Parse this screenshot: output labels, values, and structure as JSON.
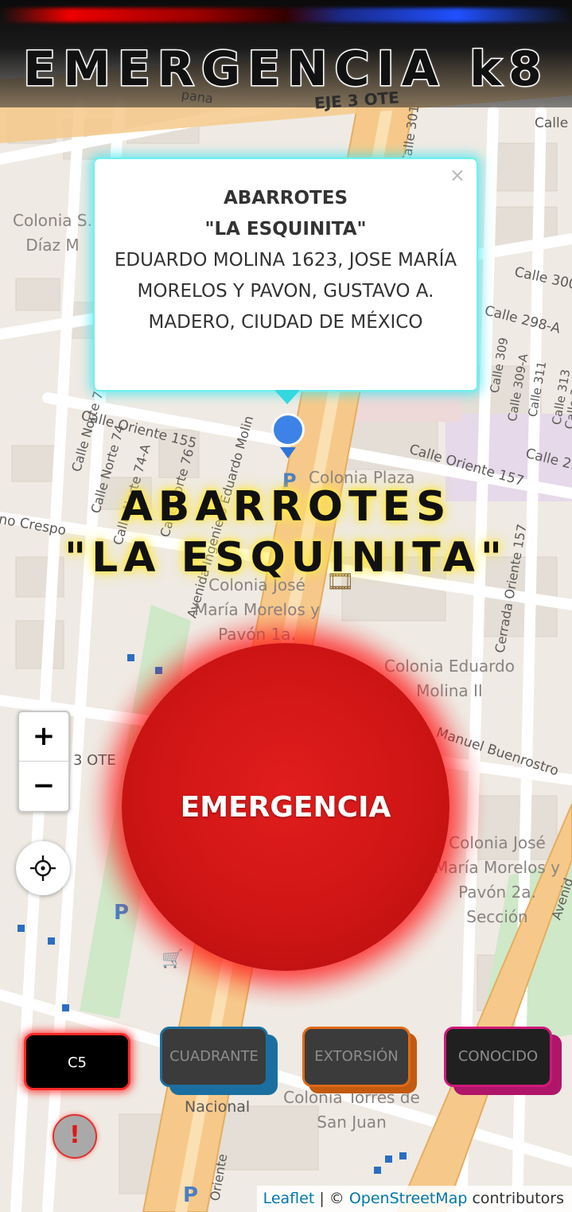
{
  "app": {
    "title": "EMERGENCIA k8"
  },
  "map": {
    "road_labels": [
      "EJE 3 OTE",
      "Calle 301",
      "Calle",
      "Calle 300",
      "Calle 298-A",
      "Calle 309",
      "Calle 309-A",
      "Calle 311",
      "Calle 313",
      "Calle 31",
      "Calle 29",
      "Calle Oriente 155",
      "Calle Oriente 157",
      "Calle Norte 72-B",
      "Calle Norte 74",
      "Calle Norte 74-A",
      "Calle Norte 76",
      "Avenida Ingeniero Eduardo Molin",
      "Cerrada Oriente 157",
      "Manuel Buenrostro",
      "3 OTE",
      "no Crespo",
      "Avenid",
      "pana",
      "Oriente",
      "Nacional"
    ],
    "area_labels": [
      "Colonia S. Díaz M",
      "Colonia Plaza",
      "Colonia José María Morelos y Pavón 1a.",
      "Colonia Eduardo Molina II",
      "Colonia José María Morelos y Pavón 2a. Sección",
      "Colonia Torres de San Juan"
    ]
  },
  "popup": {
    "close": "×",
    "name_line1": "ABARROTES",
    "name_line2": "\"LA ESQUINITA\"",
    "address": "EDUARDO MOLINA 1623, JOSE MARÍA MORELOS Y PAVON, GUSTAVO A. MADERO, CIUDAD DE MÉXICO"
  },
  "store": {
    "line1": "ABARROTES",
    "line2": "\"LA ESQUINITA\""
  },
  "emergency_button": {
    "label": "EMERGENCIA",
    "color": "#d01818"
  },
  "zoom": {
    "in": "+",
    "out": "−"
  },
  "locate": {
    "icon": "crosshair-icon"
  },
  "categories": [
    {
      "label": "C5",
      "color": "#ff2a2a"
    },
    {
      "label": "CUADRANTE",
      "color": "#1b6fa0"
    },
    {
      "label": "EXTORSIÓN",
      "color": "#e06a17"
    },
    {
      "label": "CONOCIDO",
      "color": "#d01a7a"
    }
  ],
  "alert": {
    "icon": "!"
  },
  "attribution": {
    "leaflet": "Leaflet",
    "sep": " | © ",
    "osm": "OpenStreetMap",
    "suffix": " contributors"
  }
}
